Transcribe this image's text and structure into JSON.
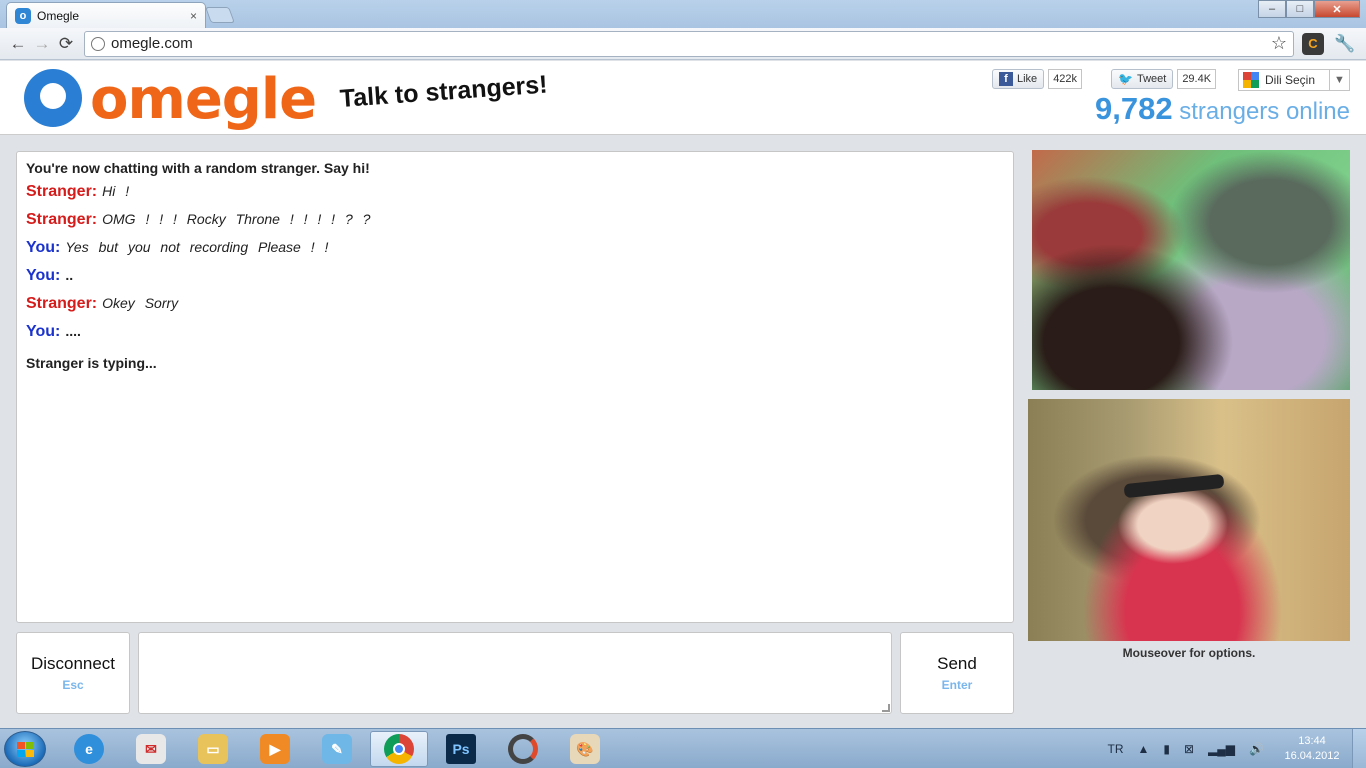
{
  "browser": {
    "tab_title": "Omegle",
    "tab_close": "×",
    "url": "omegle.com",
    "window_buttons": {
      "minimize": "–",
      "maximize": "□",
      "close": "✕"
    },
    "nav": {
      "back": "←",
      "forward": "→",
      "reload": "⟳"
    }
  },
  "header": {
    "logo_text": "omegle",
    "tagline": "Talk to strangers!",
    "like_label": "Like",
    "like_count": "422k",
    "tweet_label": "Tweet",
    "tweet_count": "29.4K",
    "language_select": "Dili Seçin",
    "online_count": "9,782",
    "online_label": "strangers online"
  },
  "chat": {
    "status": "You're now chatting with a random stranger. Say hi!",
    "messages": [
      {
        "who": "Stranger:",
        "text": "Hi  !",
        "role": "stranger"
      },
      {
        "who": "Stranger:",
        "text": "OMG ! ! !  Rocky  Throne  ! ! ! !  ? ?",
        "role": "stranger"
      },
      {
        "who": "You:",
        "text": "Yes  but  you  not  recording  Please  ! !",
        "role": "you"
      },
      {
        "who": "You:",
        "text": "..",
        "role": "you"
      },
      {
        "who": "Stranger:",
        "text": "Okey  Sorry",
        "role": "stranger"
      },
      {
        "who": "You:",
        "text": "....",
        "role": "you"
      }
    ],
    "typing": "Stranger is typing..."
  },
  "controls": {
    "disconnect_label": "Disconnect",
    "disconnect_key": "Esc",
    "send_label": "Send",
    "send_key": "Enter",
    "message_value": ""
  },
  "video": {
    "mouseover_hint": "Mouseover for options."
  },
  "taskbar": {
    "language": "TR",
    "time": "13:44",
    "date": "16.04.2012",
    "apps": [
      "internet-explorer",
      "mail",
      "file-explorer",
      "media-player",
      "notepad",
      "chrome",
      "photoshop",
      "app-ring",
      "paint"
    ]
  },
  "colors": {
    "stranger": "#d61b1b",
    "you": "#1b33cc",
    "brand_orange": "#f06619",
    "brand_blue": "#2a7fd4"
  }
}
